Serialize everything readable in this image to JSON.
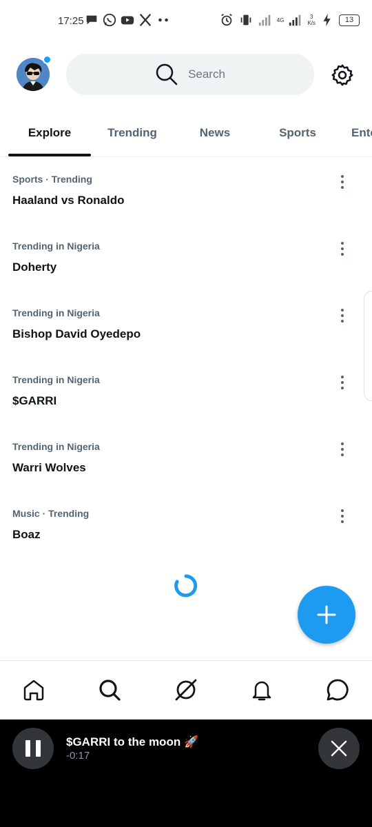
{
  "status_bar": {
    "time": "17:25",
    "network": "4G",
    "speed_value": "3",
    "speed_unit": "K/s",
    "battery": "13"
  },
  "search": {
    "placeholder": "Search"
  },
  "tabs": [
    {
      "label": "Explore",
      "active": true
    },
    {
      "label": "Trending"
    },
    {
      "label": "News"
    },
    {
      "label": "Sports"
    },
    {
      "label": "Ente"
    }
  ],
  "trends": [
    {
      "context": "Sports · Trending",
      "title": "Haaland vs Ronaldo"
    },
    {
      "context": "Trending in Nigeria",
      "title": "Doherty"
    },
    {
      "context": "Trending in Nigeria",
      "title": "Bishop David Oyedepo"
    },
    {
      "context": "Trending in Nigeria",
      "title": "$GARRI"
    },
    {
      "context": "Trending in Nigeria",
      "title": "Warri Wolves"
    },
    {
      "context": "Music · Trending",
      "title": "Boaz"
    }
  ],
  "player": {
    "title": "$GARRI to the moon 🚀",
    "time": "-0:17"
  },
  "icons": {
    "status_left": [
      "message-icon",
      "whatsapp-icon",
      "youtube-icon",
      "x-icon",
      "more-dots-icon"
    ],
    "status_right": [
      "alarm-icon",
      "vibrate-icon",
      "signal-icon",
      "charging-icon"
    ],
    "nav": [
      "home-icon",
      "search-icon",
      "grok-icon",
      "notifications-icon",
      "messages-icon"
    ]
  },
  "colors": {
    "accent": "#1d9bf0",
    "text_primary": "#0f1419",
    "text_secondary": "#536471",
    "player_bg": "#000000"
  }
}
